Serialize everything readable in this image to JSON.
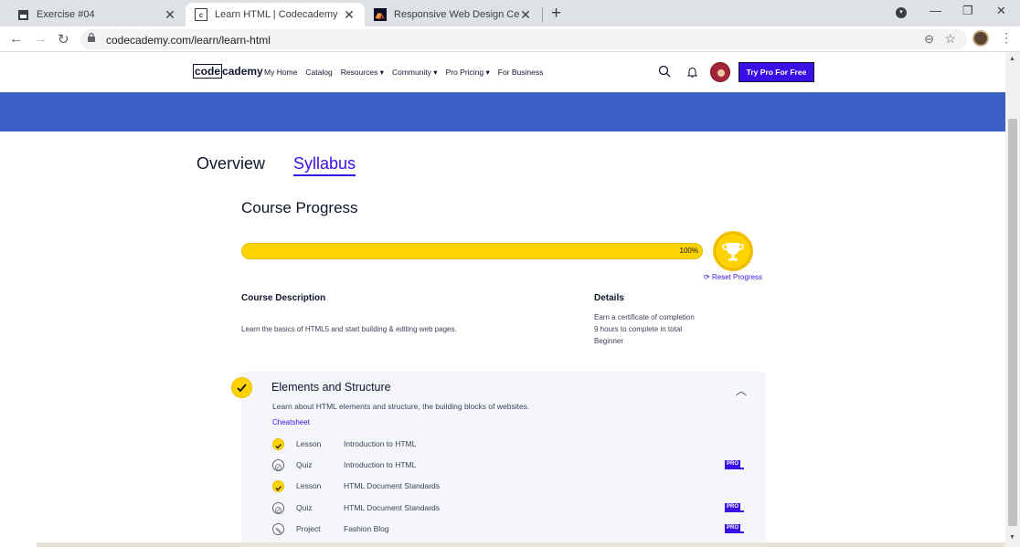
{
  "browser": {
    "tabs": [
      {
        "title": "Exercise #04",
        "icon": "document-icon"
      },
      {
        "title": "Learn HTML | Codecademy",
        "icon": "codecademy-icon"
      },
      {
        "title": "Responsive Web Design Certificat",
        "icon": "fcc-icon"
      }
    ],
    "url": "codecademy.com/learn/learn-html"
  },
  "header": {
    "logo_code": "code",
    "logo_rest": "cademy",
    "nav": [
      "My Home",
      "Catalog",
      "Resources ▾",
      "Community ▾",
      "Pro Pricing ▾",
      "For Business"
    ],
    "cta": "Try Pro For Free"
  },
  "tabs": {
    "overview": "Overview",
    "syllabus": "Syllabus"
  },
  "progress": {
    "title": "Course Progress",
    "percent_label": "100%",
    "percent": 100,
    "reset": "Reset Progress"
  },
  "description": {
    "heading": "Course Description",
    "text": "Learn the basics of HTML5 and start building & editing web pages."
  },
  "details": {
    "heading": "Details",
    "lines": [
      "Earn a certificate of completion",
      "9 hours to complete in total",
      "Beginner"
    ]
  },
  "module": {
    "title": "Elements and Structure",
    "description": "Learn about HTML elements and structure, the building blocks of websites.",
    "cheatsheet": "Cheatsheet",
    "items": [
      {
        "type": "Lesson",
        "name": "Introduction to HTML",
        "done": true,
        "pro": false
      },
      {
        "type": "Quiz",
        "name": "Introduction to HTML",
        "done": false,
        "pro": true
      },
      {
        "type": "Lesson",
        "name": "HTML Document Standards",
        "done": true,
        "pro": false
      },
      {
        "type": "Quiz",
        "name": "HTML Document Standards",
        "done": false,
        "pro": true
      },
      {
        "type": "Project",
        "name": "Fashion Blog",
        "done": false,
        "pro": true
      }
    ],
    "pro_badge": "PRO"
  },
  "colors": {
    "accent": "#3a10e5",
    "banner": "#3a5fc5",
    "progress": "#ffd300"
  }
}
